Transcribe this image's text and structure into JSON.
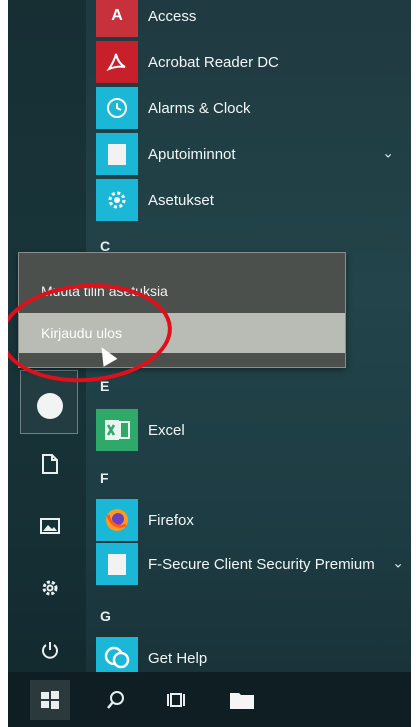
{
  "apps": [
    {
      "label": "Access",
      "tile_color": "#c7313b",
      "tile_glyph": "A",
      "icon": "access-icon"
    },
    {
      "label": "Acrobat Reader DC",
      "tile_color": "#c8202a",
      "tile_glyph": "⟡",
      "icon": "acrobat-icon"
    },
    {
      "label": "Alarms & Clock",
      "tile_color": "#1bb7d6",
      "tile_glyph": "◷",
      "icon": "clock-icon"
    },
    {
      "label": "Aputoiminnot",
      "tile_color": "#1bb7d6",
      "tile_glyph": "▭",
      "icon": "folder-icon"
    },
    {
      "label": "Asetukset",
      "tile_color": "#1bb7d6",
      "tile_glyph": "⚙",
      "icon": "gear-icon"
    },
    {
      "label": "Excel",
      "tile_color": "#2fa96a",
      "tile_glyph": "X",
      "icon": "excel-icon"
    },
    {
      "label": "Firefox",
      "tile_color": "#1bb7d6",
      "tile_glyph": "◉",
      "icon": "firefox-icon"
    },
    {
      "label": "F-Secure Client Security Premium",
      "tile_color": "#1bb7d6",
      "tile_glyph": "▭",
      "icon": "folder-icon"
    },
    {
      "label": "Get Help",
      "tile_color": "#1bb7d6",
      "tile_glyph": "💬",
      "icon": "help-icon"
    }
  ],
  "letters": [
    "C",
    "E",
    "F",
    "G"
  ],
  "context_menu": {
    "items": [
      "Muuta tilin asetuksia",
      "Kirjaudu ulos"
    ]
  },
  "expand_glyph": "⌄",
  "highlight_color": "#e0101a"
}
